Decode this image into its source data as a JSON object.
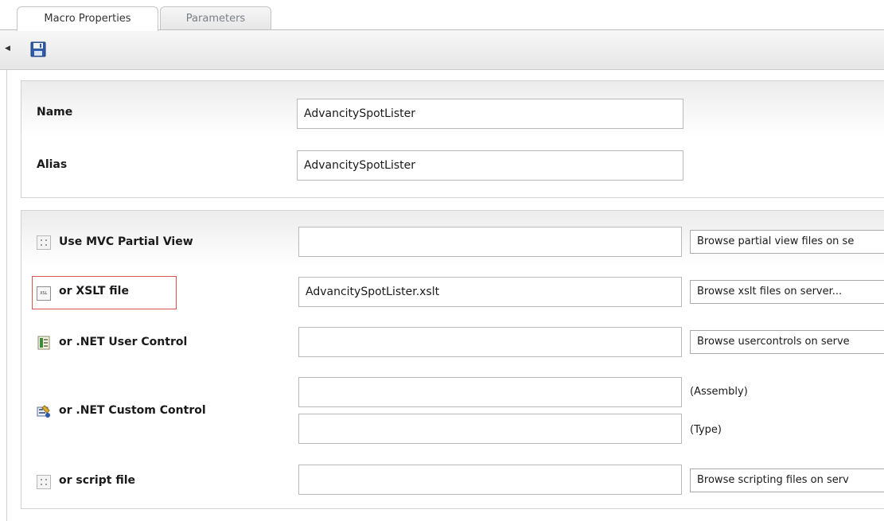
{
  "tabs": [
    {
      "label": "Macro Properties",
      "active": true
    },
    {
      "label": "Parameters",
      "active": false
    }
  ],
  "toolbar": {
    "collapse_icon": "triangle-left-icon",
    "save_icon": "save-floppy-icon"
  },
  "properties": {
    "name": {
      "label": "Name",
      "value": "AdvancitySpotLister"
    },
    "alias": {
      "label": "Alias",
      "value": "AdvancitySpotLister"
    }
  },
  "sources": {
    "mvc": {
      "label": "Use MVC Partial View",
      "value": "",
      "browse": "Browse partial view files on se",
      "icon": "file-dots-icon"
    },
    "xslt": {
      "label": "or XSLT file",
      "value": "AdvancitySpotLister.xslt",
      "browse": "Browse xslt files on server...",
      "icon": "xsl-file-icon",
      "icon_text": "XSL"
    },
    "usercontrol": {
      "label": "or .NET User Control",
      "value": "",
      "browse": "Browse usercontrols on serve",
      "icon": "user-control-icon"
    },
    "customcontrol": {
      "label": "or .NET Custom Control",
      "assembly_value": "",
      "assembly_note": "(Assembly)",
      "type_value": "",
      "type_note": "(Type)",
      "icon": "custom-control-icon"
    },
    "script": {
      "label": "or script file",
      "value": "",
      "browse": "Browse scripting files on serv",
      "icon": "file-dots-icon"
    }
  },
  "colors": {
    "highlight": "#d9534f",
    "save_icon": "#2e5aa8"
  }
}
